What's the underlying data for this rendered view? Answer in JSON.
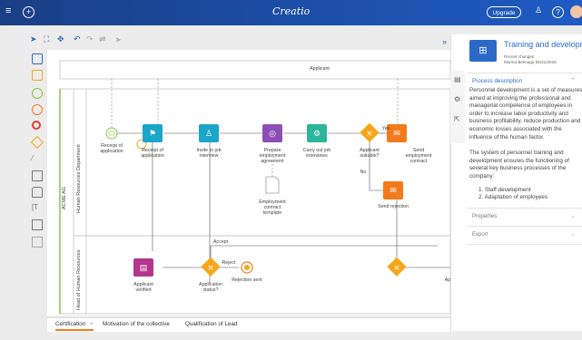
{
  "brand": "Creatio",
  "top_bar": {
    "upgrade_label": "Upgrade"
  },
  "diagram": {
    "pool_label": "Applicant",
    "company_label": "ACME AG",
    "lane1_label": "Human Resources Department",
    "lane2_label": "Head of Human Resources",
    "elements": {
      "receipt_event": "Receipt of application",
      "receipt_task": "Receipt of application",
      "invite_task": "Invite to job interview",
      "prepare_task": "Prepare employment agreement",
      "document": "Employment contract template",
      "carry_out": "Carry out job interviews",
      "applicant_suitable": "Applicant suitable?",
      "yes_label": "Yes",
      "no_label": "No",
      "send_contract": "Send employment contract",
      "send_rejection": "Send rejection",
      "accept_label": "Accept",
      "reject_label": "Reject",
      "applicant_verified": "Applicant verified",
      "application_status": "Application status?",
      "rejection_sent": "Rejection sent",
      "ap_partial": "Ap"
    }
  },
  "tabs": [
    {
      "label": "Certification",
      "close": "×"
    },
    {
      "label": "Motivation of the collective"
    },
    {
      "label": "Qualification of Lead"
    }
  ],
  "panel": {
    "collapse_icon": "»",
    "title": "Training and development",
    "meta_line1": "Recent changes:",
    "meta_line2": "Marina Belmaga 05/21/2018",
    "section_description": "Process description",
    "description_p1": "Personnel development is a set of measures aimed at improving the professional and managerial competence of employees in order to increase labor productivity and business profitability, reduce production and economic losses associated with the influence of the human factor.",
    "description_p2": "The system of personnel training and development ensures the functioning of several key business processes of the company:",
    "list_item1": "1. Staff development",
    "list_item2": "2. Adaptation of employees",
    "section_properties": "Properties",
    "section_export": "Export"
  },
  "colors": {
    "topbar": "#1f4fa8",
    "accent_blue": "#2b69c8",
    "task_teal": "#1ba6c9",
    "task_purple": "#8d4fb5",
    "task_green": "#2bb59a",
    "gateway_orange": "#f6a61a",
    "task_orange": "#f27a1c",
    "task_magenta": "#b6338e"
  }
}
